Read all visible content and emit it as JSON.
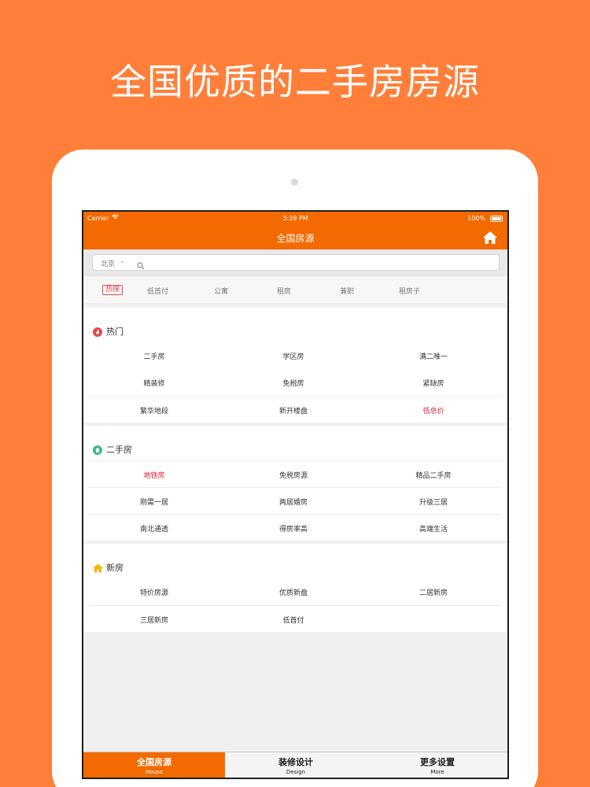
{
  "headline": "全国优质的二手房房源",
  "status_bar": {
    "carrier": "Carrier",
    "time": "3:39 PM",
    "battery": "100%"
  },
  "nav": {
    "title": "全国房源",
    "home_icon": "home-icon"
  },
  "search": {
    "city": "北京",
    "placeholder": ""
  },
  "tags": [
    "热搜",
    "低首付",
    "公寓",
    "租房",
    "兼职",
    "租房子"
  ],
  "sections": [
    {
      "title": "热门",
      "icon": "flame-icon",
      "rows": [
        [
          "二手房",
          "学区房",
          "满二唯一"
        ],
        [
          "精装修",
          "免税房",
          "紧缺房"
        ],
        [
          "繁华地段",
          "新开楼盘",
          "低总价"
        ]
      ]
    },
    {
      "title": "二手房",
      "icon": "secondhand-house-icon",
      "rows": [
        [
          "地铁房",
          "免税房源",
          "精品二手房"
        ],
        [
          "刚需一居",
          "两居婚房",
          "升级三居"
        ],
        [
          "南北通透",
          "得房率高",
          "高端生活"
        ]
      ]
    },
    {
      "title": "新房",
      "icon": "house-icon",
      "rows": [
        [
          "特价房源",
          "优质新盘",
          "二居新房"
        ],
        [
          "三居新房",
          "低首付",
          ""
        ]
      ]
    }
  ],
  "highlight_color": "#e0232f",
  "accent_color": "#F26A00",
  "tabbar": [
    {
      "label": "全国房源",
      "sub": "House"
    },
    {
      "label": "装修设计",
      "sub": "Design"
    },
    {
      "label": "更多设置",
      "sub": "More"
    }
  ]
}
